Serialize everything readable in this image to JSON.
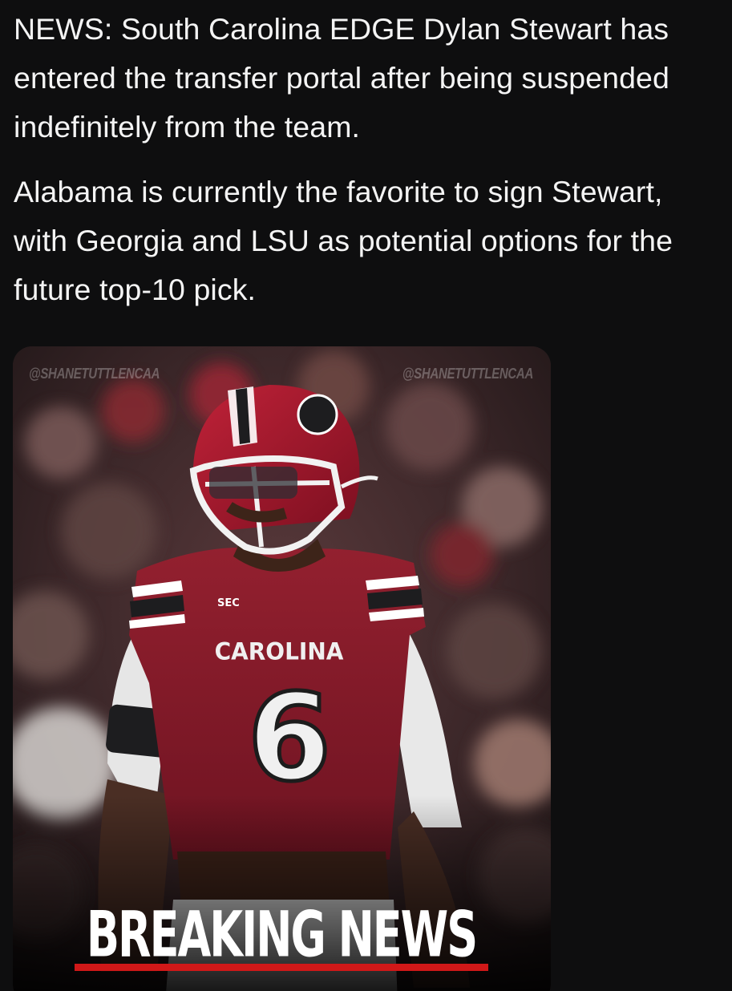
{
  "post": {
    "paragraph1": "NEWS: South Carolina EDGE Dylan Stewart has entered the transfer portal after being suspended indefinitely from the team.",
    "paragraph2": "Alabama is currently the favorite to sign Stewart, with Georgia and LSU as potential options for the future top-10 pick."
  },
  "media": {
    "watermark_left": "@SHANETUTTLENCAA",
    "watermark_right": "@SHANETUTTLENCAA",
    "jersey_text": "CAROLINA",
    "jersey_number": "6",
    "jersey_patch": "SEC",
    "banner_text": "BREAKING NEWS",
    "colors": {
      "jersey": "#8b1a2b",
      "helmet": "#a3162c",
      "banner_bar": "#d01818"
    }
  }
}
